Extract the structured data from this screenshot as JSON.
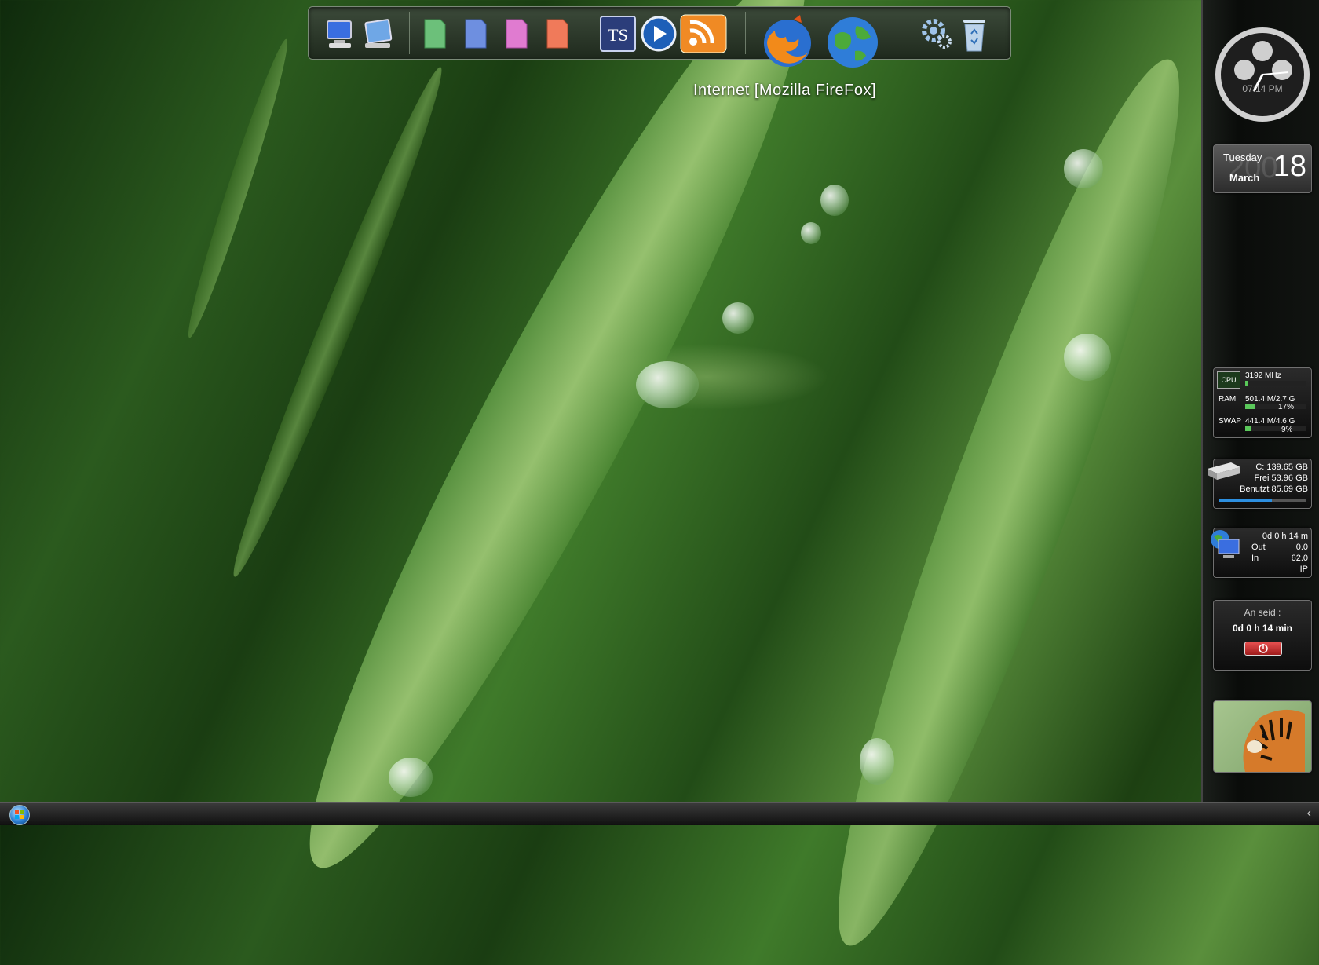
{
  "dock": {
    "icons": [
      {
        "name": "my-computer-icon"
      },
      {
        "name": "control-panel-icon"
      },
      {
        "name": "green-folder-icon",
        "color": "#6cc07a"
      },
      {
        "name": "blue-folder-icon",
        "color": "#6e8fe0"
      },
      {
        "name": "pink-folder-icon",
        "color": "#e07bd0"
      },
      {
        "name": "orange-folder-icon",
        "color": "#f07a5a"
      },
      {
        "name": "ts-app-icon"
      },
      {
        "name": "media-player-icon"
      },
      {
        "name": "rss-feed-icon",
        "color": "#f08a24"
      },
      {
        "name": "firefox-icon"
      },
      {
        "name": "internet-globe-icon"
      },
      {
        "name": "settings-gear-icon"
      },
      {
        "name": "recycle-bin-icon"
      }
    ],
    "tooltip": "Internet [Mozilla FireFox]"
  },
  "clock": {
    "time": "07:14 PM"
  },
  "calendar": {
    "weekday": "Tuesday",
    "month": "March",
    "day": "18",
    "year_watermark": "200"
  },
  "system_monitor": {
    "cpu_label": "CPU",
    "cpu_mhz": "3192 MHz",
    "cpu_pct": "4.4%",
    "cpu_value": 0.044,
    "ram_label": "RAM",
    "ram_usage": "501.4 M/2.7 G",
    "ram_pct": "17%",
    "ram_value": 0.17,
    "swap_label": "SWAP",
    "swap_usage": "441.4 M/4.6 G",
    "swap_pct": "9%",
    "swap_value": 0.09
  },
  "drive": {
    "label": "C: 139.65 GB",
    "free": "Frei 53.96 GB",
    "used": "Benutzt 85.69 GB",
    "used_fraction": 0.61
  },
  "network": {
    "uptime": "0d 0 h 14 m",
    "out_label": "Out",
    "out_value": "0.0",
    "in_label": "In",
    "in_value": "62.0",
    "ip_label": "IP"
  },
  "uptime_gadget": {
    "title": "An seid :",
    "value": "0d 0 h 14 min"
  },
  "taskbar": {
    "expand_glyph": "‹"
  },
  "colors": {
    "accent": "#2d7fd4",
    "shutdown": "#c42a2a"
  }
}
